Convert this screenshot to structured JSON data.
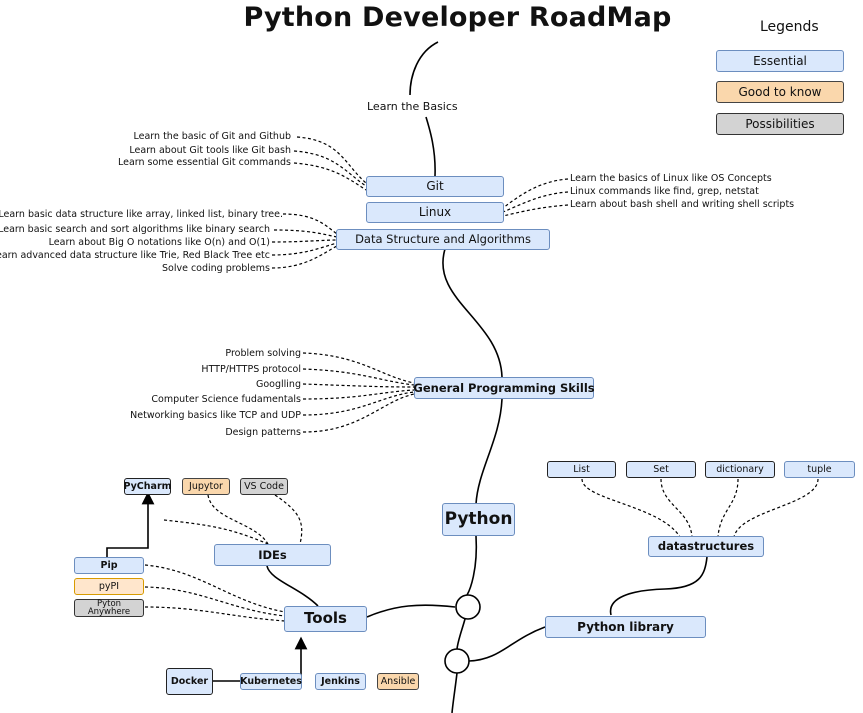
{
  "title": "Python Developer RoadMap",
  "legend": {
    "title": "Legends",
    "essential": "Essential",
    "good_to_know": "Good to know",
    "possibilities": "Possibilities"
  },
  "main_path": {
    "learn_basics": "Learn the Basics",
    "git": "Git",
    "linux": "Linux",
    "dsa": "Data Structure and Algorithms",
    "gps": "General Programming Skills",
    "python": "Python"
  },
  "git_notes": [
    "Learn the basic of Git and Github",
    "Learn about Git tools like Git bash",
    "Learn some essential Git commands"
  ],
  "linux_notes": [
    "Learn the basics of Linux like OS Concepts",
    "Linux commands like find, grep, netstat",
    "Learn about bash shell and writing shell scripts"
  ],
  "dsa_notes": [
    "Learn basic data structure like array, linked list, binary tree.",
    "Learn basic search and sort algorithms like binary search",
    "Learn about Big O notations like O(n) and O(1)",
    "Learn advanced data structure like Trie, Red Black Tree etc",
    "Solve coding problems"
  ],
  "gps_notes": [
    "Problem solving",
    "HTTP/HTTPS protocol",
    "Googlling",
    "Computer Science fudamentals",
    "Networking basics like TCP and UDP",
    "Design patterns"
  ],
  "tools": {
    "tools": "Tools",
    "ides": "IDEs",
    "pycharm": "PyCharm",
    "jupytor": "Jupytor",
    "vscode": "VS Code",
    "pip": "Pip",
    "pypi": "pyPI",
    "pythonanywhere": "Pyton Anywhere",
    "docker": "Docker",
    "kubernetes": "Kubernetes",
    "jenkins": "Jenkins",
    "ansible": "Ansible"
  },
  "library": {
    "python_library": "Python library",
    "datastructures": "datastructures",
    "list": "List",
    "set": "Set",
    "dictionary": "dictionary",
    "tuple": "tuple"
  }
}
